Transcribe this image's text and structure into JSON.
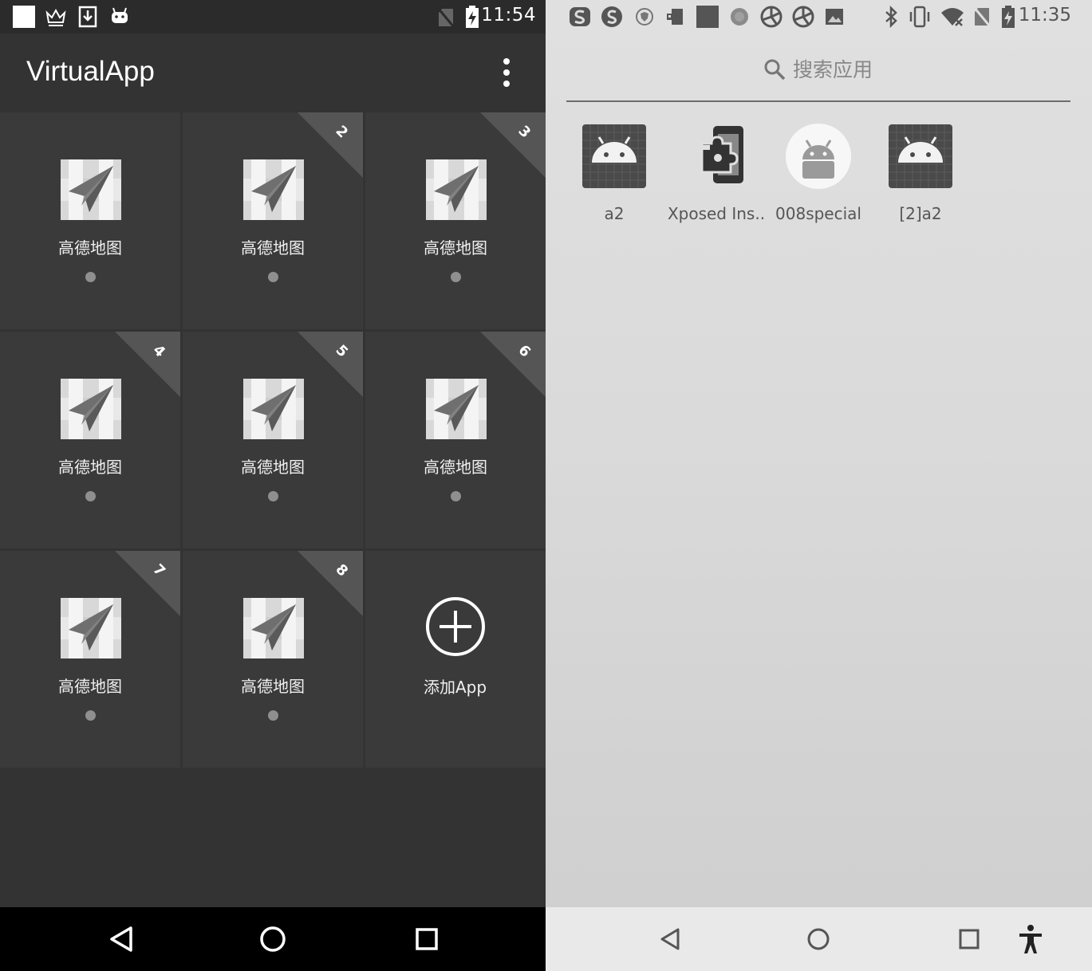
{
  "left_pane": {
    "status_bar": {
      "time": "11:54",
      "icons": [
        "white-square-icon",
        "crown-icon",
        "download-icon",
        "android-icon",
        "no-sim-icon",
        "battery-charging-icon"
      ]
    },
    "app_bar": {
      "title": "VirtualApp",
      "menu_icon": "more-vert-icon"
    },
    "app_grid": [
      {
        "label": "高德地图",
        "badge": ""
      },
      {
        "label": "高德地图",
        "badge": "2"
      },
      {
        "label": "高德地图",
        "badge": "3"
      },
      {
        "label": "高德地图",
        "badge": "4"
      },
      {
        "label": "高德地图",
        "badge": "5"
      },
      {
        "label": "高德地图",
        "badge": "6"
      },
      {
        "label": "高德地图",
        "badge": "7"
      },
      {
        "label": "高德地图",
        "badge": "8"
      }
    ],
    "add_tile": {
      "label": "添加App",
      "icon": "add-circle-icon"
    },
    "nav_bar": [
      "back-icon",
      "home-icon",
      "recents-icon"
    ]
  },
  "right_pane": {
    "status_bar": {
      "time": "11:35",
      "icons": [
        "sogou-icon",
        "sogou-s-icon",
        "shield-icon",
        "image-flag-icon",
        "square-icon",
        "circle-dots-icon",
        "aperture-icon",
        "aperture-icon-2",
        "picture-icon",
        "bluetooth-icon",
        "vibrate-icon",
        "wifi-off-icon",
        "no-sim-icon",
        "battery-charging-icon"
      ]
    },
    "search": {
      "placeholder": "搜索应用"
    },
    "apps": [
      {
        "label": "a2",
        "icon": "android-grid-icon"
      },
      {
        "label": "Xposed Ins..",
        "icon": "xposed-puzzle-icon"
      },
      {
        "label": "008special",
        "icon": "android-round-icon"
      },
      {
        "label": "[2]a2",
        "icon": "android-grid-icon"
      }
    ],
    "nav_bar": [
      "back-icon",
      "home-icon",
      "recents-icon",
      "accessibility-icon"
    ]
  },
  "colors": {
    "left_bg": "#333333",
    "tile_bg": "#3a3a3a",
    "badge": "#555555",
    "right_bg": "#dcdcdc"
  }
}
